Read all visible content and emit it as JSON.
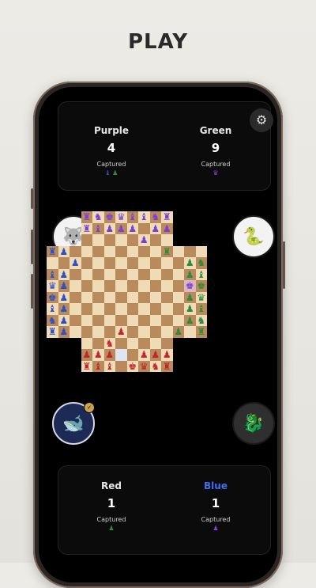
{
  "headline": "PLAY",
  "top_panel": {
    "players": [
      {
        "name": "Purple",
        "count": "4",
        "label": "Captured",
        "captured": "♝ ♟",
        "captured_colors": [
          "#3b4fd1",
          "#2a8f3a"
        ]
      },
      {
        "name": "Green",
        "count": "9",
        "label": "Captured",
        "captured": "♛",
        "captured_colors": [
          "#8a3fd1"
        ]
      }
    ],
    "settings_icon": "⚙"
  },
  "bottom_panel": {
    "players": [
      {
        "name": "Red",
        "count": "1",
        "label": "Captured",
        "captured": "♟",
        "captured_colors": [
          "#2a8f3a"
        ],
        "name_color": "#e6e6e6"
      },
      {
        "name": "Blue",
        "count": "1",
        "label": "Captured",
        "captured": "♟",
        "captured_colors": [
          "#8a3fd1"
        ],
        "name_color": "#3f6ef0"
      }
    ]
  },
  "buttons": {
    "top_left": {
      "icon": "wolf-icon",
      "glyph": "🐺"
    },
    "top_right": {
      "icon": "snake-icon",
      "glyph": "🐍"
    },
    "bottom_left": {
      "icon": "whale-icon",
      "glyph": "🐋",
      "badge": "✓"
    },
    "bottom_right": {
      "icon": "dragon-icon",
      "glyph": "🐉"
    }
  },
  "colors": {
    "purple": "#7a3fd6",
    "green": "#2e8a3c",
    "red": "#c0262c",
    "blue": "#2f4fc4",
    "light_square": "#efdcb6",
    "dark_square": "#b88a5c",
    "highlight": "#dfe6f2"
  },
  "board": {
    "pieces": [
      {
        "sq": "3,0",
        "g": "♜",
        "c": "purple"
      },
      {
        "sq": "4,0",
        "g": "♞",
        "c": "purple"
      },
      {
        "sq": "5,0",
        "g": "♚",
        "c": "purple"
      },
      {
        "sq": "6,0",
        "g": "♛",
        "c": "purple"
      },
      {
        "sq": "7,0",
        "g": "♝",
        "c": "purple"
      },
      {
        "sq": "8,0",
        "g": "♝",
        "c": "purple"
      },
      {
        "sq": "9,0",
        "g": "♞",
        "c": "purple"
      },
      {
        "sq": "10,0",
        "g": "♜",
        "c": "purple"
      },
      {
        "sq": "3,1",
        "g": "♜",
        "c": "purple"
      },
      {
        "sq": "4,1",
        "g": "♝",
        "c": "purple"
      },
      {
        "sq": "5,1",
        "g": "♟",
        "c": "purple"
      },
      {
        "sq": "6,1",
        "g": "♟",
        "c": "purple"
      },
      {
        "sq": "7,1",
        "g": "♟",
        "c": "purple"
      },
      {
        "sq": "9,1",
        "g": "♟",
        "c": "purple"
      },
      {
        "sq": "10,1",
        "g": "♟",
        "c": "purple"
      },
      {
        "sq": "8,2",
        "g": "♟",
        "c": "purple"
      },
      {
        "sq": "0,3",
        "g": "♜",
        "c": "blue"
      },
      {
        "sq": "1,3",
        "g": "♟",
        "c": "blue"
      },
      {
        "sq": "2,4",
        "g": "♟",
        "c": "blue"
      },
      {
        "sq": "0,5",
        "g": "♝",
        "c": "blue"
      },
      {
        "sq": "1,5",
        "g": "♟",
        "c": "blue"
      },
      {
        "sq": "0,6",
        "g": "♛",
        "c": "blue"
      },
      {
        "sq": "1,6",
        "g": "♟",
        "c": "blue"
      },
      {
        "sq": "0,7",
        "g": "♚",
        "c": "blue"
      },
      {
        "sq": "1,7",
        "g": "♟",
        "c": "blue"
      },
      {
        "sq": "0,8",
        "g": "♝",
        "c": "blue"
      },
      {
        "sq": "1,8",
        "g": "♟",
        "c": "blue"
      },
      {
        "sq": "0,9",
        "g": "♞",
        "c": "blue"
      },
      {
        "sq": "1,9",
        "g": "♟",
        "c": "blue"
      },
      {
        "sq": "0,10",
        "g": "♜",
        "c": "blue"
      },
      {
        "sq": "1,10",
        "g": "♟",
        "c": "blue"
      },
      {
        "sq": "10,3",
        "g": "♜",
        "c": "green"
      },
      {
        "sq": "12,4",
        "g": "♟",
        "c": "green"
      },
      {
        "sq": "13,4",
        "g": "♞",
        "c": "green"
      },
      {
        "sq": "12,5",
        "g": "♟",
        "c": "green"
      },
      {
        "sq": "13,5",
        "g": "♝",
        "c": "green"
      },
      {
        "sq": "12,6",
        "g": "♚",
        "c": "purple"
      },
      {
        "sq": "13,6",
        "g": "♚",
        "c": "green"
      },
      {
        "sq": "12,7",
        "g": "♟",
        "c": "green"
      },
      {
        "sq": "13,7",
        "g": "♛",
        "c": "green"
      },
      {
        "sq": "12,8",
        "g": "♟",
        "c": "green"
      },
      {
        "sq": "13,8",
        "g": "♝",
        "c": "green"
      },
      {
        "sq": "12,9",
        "g": "♟",
        "c": "green"
      },
      {
        "sq": "13,9",
        "g": "♞",
        "c": "green"
      },
      {
        "sq": "11,10",
        "g": "♟",
        "c": "green"
      },
      {
        "sq": "13,10",
        "g": "♜",
        "c": "green"
      },
      {
        "sq": "6,10",
        "g": "♟",
        "c": "red"
      },
      {
        "sq": "5,11",
        "g": "♞",
        "c": "red"
      },
      {
        "sq": "3,12",
        "g": "♟",
        "c": "red"
      },
      {
        "sq": "4,12",
        "g": "♟",
        "c": "red"
      },
      {
        "sq": "5,12",
        "g": "♟",
        "c": "red"
      },
      {
        "sq": "8,12",
        "g": "♟",
        "c": "red"
      },
      {
        "sq": "9,12",
        "g": "♟",
        "c": "red"
      },
      {
        "sq": "10,12",
        "g": "♟",
        "c": "red"
      },
      {
        "sq": "3,13",
        "g": "♜",
        "c": "red"
      },
      {
        "sq": "4,13",
        "g": "♝",
        "c": "red"
      },
      {
        "sq": "5,13",
        "g": "♝",
        "c": "red"
      },
      {
        "sq": "7,13",
        "g": "♚",
        "c": "red"
      },
      {
        "sq": "8,13",
        "g": "♛",
        "c": "red"
      },
      {
        "sq": "9,13",
        "g": "♞",
        "c": "red"
      },
      {
        "sq": "10,13",
        "g": "♜",
        "c": "red"
      }
    ],
    "highlights": [
      "6,12"
    ],
    "check_squares": [
      "12,6"
    ]
  }
}
